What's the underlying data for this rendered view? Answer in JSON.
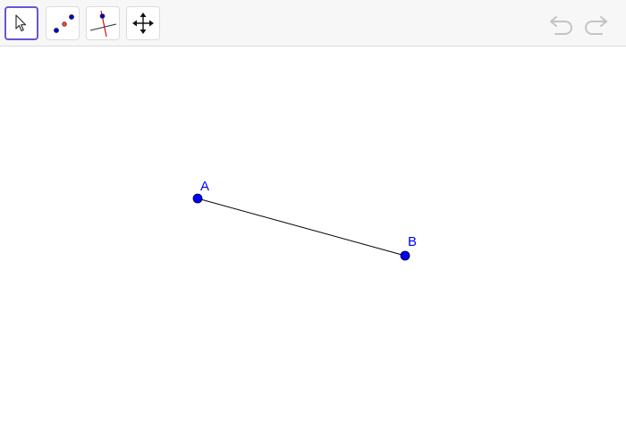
{
  "toolbar": {
    "tools": [
      {
        "name": "move",
        "icon": "arrow-cursor-icon",
        "active": true
      },
      {
        "name": "point",
        "icon": "points-icon",
        "active": false
      },
      {
        "name": "perpendicular-line",
        "icon": "perpendicular-line-icon",
        "active": false
      },
      {
        "name": "move-graphics-view",
        "icon": "move-arrows-icon",
        "active": false
      }
    ],
    "undo_icon": "undo-icon",
    "redo_icon": "redo-icon"
  },
  "graphics": {
    "points": {
      "A": {
        "label": "A"
      },
      "B": {
        "label": "B"
      }
    },
    "segment": {
      "from": "A",
      "to": "B"
    },
    "point_color": "#0000ff",
    "segment_color": "#000000"
  },
  "colors": {
    "active_tool_border": "#6557d2",
    "icon_blue": "#0000ff",
    "icon_red": "#cc0000",
    "disabled_icon": "#c4c4c4"
  }
}
